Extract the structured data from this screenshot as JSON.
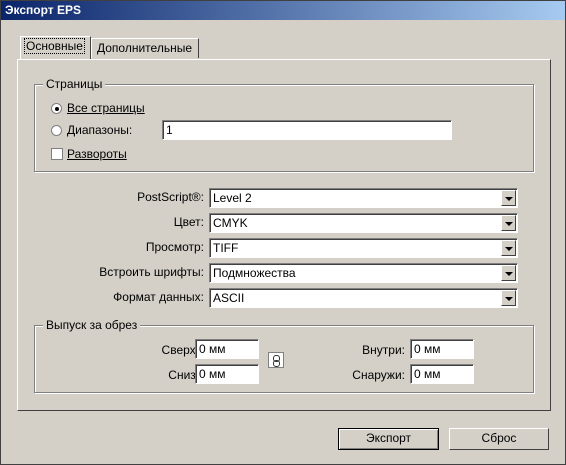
{
  "window": {
    "title": "Экспорт EPS"
  },
  "tabs": [
    {
      "label": "Основные",
      "active": true
    },
    {
      "label": "Дополнительные",
      "active": false
    }
  ],
  "pages_group": {
    "legend": "Страницы",
    "all_pages": {
      "label": "Все страницы",
      "checked": true
    },
    "ranges": {
      "label": "Диапазоны:",
      "checked": false,
      "value": "1"
    },
    "spreads": {
      "label": "Развороты",
      "checked": false
    }
  },
  "settings": {
    "postscript": {
      "label": "PostScript®:",
      "value": "Level 2"
    },
    "color": {
      "label": "Цвет:",
      "value": "CMYK"
    },
    "preview": {
      "label": "Просмотр:",
      "value": "TIFF"
    },
    "embed_fonts": {
      "label": "Встроить шрифты:",
      "value": "Подмножества"
    },
    "data_format": {
      "label": "Формат данных:",
      "value": "ASCII"
    }
  },
  "bleed_group": {
    "legend": "Выпуск за обрез",
    "top": {
      "label": "Сверху:",
      "value": "0 мм"
    },
    "bottom": {
      "label": "Снизу:",
      "value": "0 мм"
    },
    "inside": {
      "label": "Внутри:",
      "value": "0 мм"
    },
    "outside": {
      "label": "Снаружи:",
      "value": "0 мм"
    }
  },
  "buttons": {
    "export": "Экспорт",
    "reset": "Сброс"
  },
  "icons": {
    "link": "chain-link-icon",
    "dropdown": "chevron-down-icon"
  }
}
